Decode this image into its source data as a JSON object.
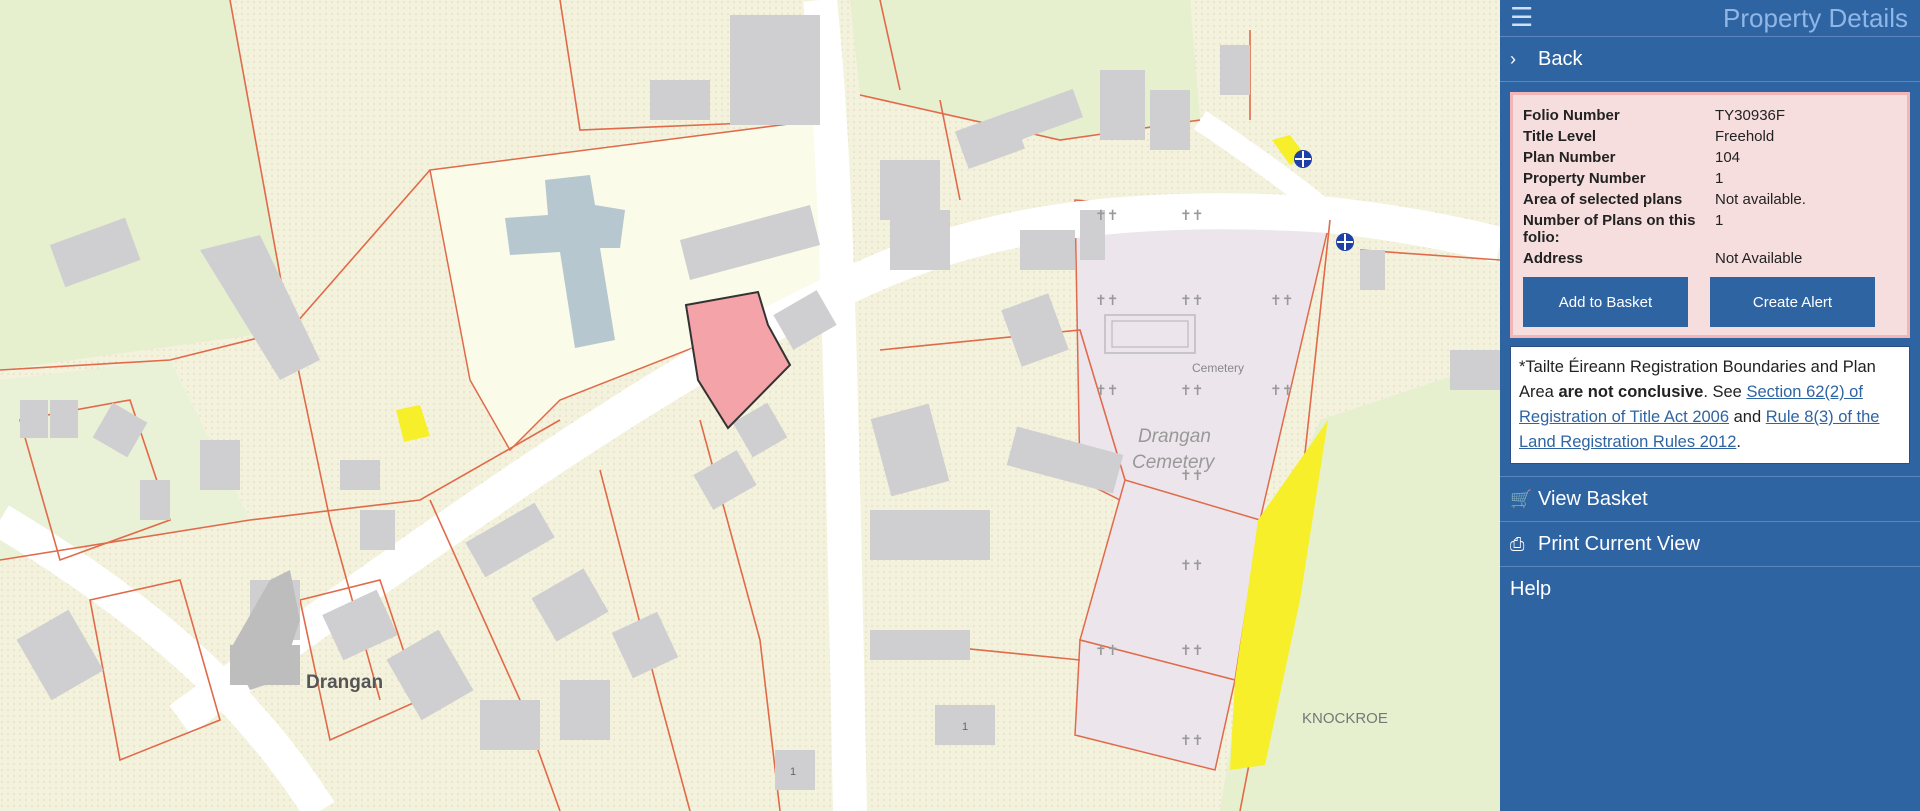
{
  "panel": {
    "title": "Property Details",
    "back_label": "Back",
    "details": {
      "rows": [
        {
          "key": "Folio Number",
          "value": "TY30936F"
        },
        {
          "key": "Title Level",
          "value": "Freehold"
        },
        {
          "key": "Plan Number",
          "value": "104"
        },
        {
          "key": "Property Number",
          "value": "1"
        },
        {
          "key": "Area of selected plans",
          "value": "Not available."
        },
        {
          "key": "Number of Plans on this folio:",
          "value": "1"
        },
        {
          "key": "Address",
          "value": "Not Available"
        }
      ],
      "add_basket_label": "Add to Basket",
      "create_alert_label": "Create Alert"
    },
    "disclaimer": {
      "part1": "*Tailte Éireann Registration Boundaries and Plan Area ",
      "bold": "are not conclusive",
      "part2": ". See ",
      "link1": "Section 62(2) of Registration of Title Act 2006",
      "part3": " and ",
      "link2": "Rule 8(3) of the Land Registration Rules 2012",
      "part4": "."
    },
    "menu": {
      "view_basket": "View Basket",
      "print_view": "Print Current View",
      "help": "Help"
    }
  },
  "map": {
    "labels": {
      "town": "Drangan",
      "cemetery_small": "Cemetery",
      "cemetery_line1": "Drangan",
      "cemetery_line2": "Cemetery",
      "townland": "KNOCKROE",
      "house_number": "1"
    }
  },
  "colors": {
    "panel_bg": "#2f64a3",
    "selected_plot": "#f4a3a8",
    "boundary": "#e06a4a",
    "highlight": "#f6ef2a"
  }
}
